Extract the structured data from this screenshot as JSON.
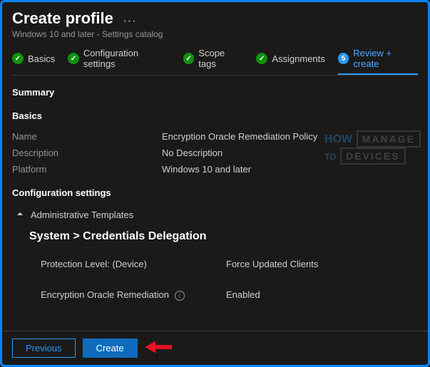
{
  "header": {
    "title": "Create profile",
    "subtitle": "Windows 10 and later - Settings catalog"
  },
  "wizard": {
    "steps": [
      {
        "label": "Basics"
      },
      {
        "label": "Configuration settings"
      },
      {
        "label": "Scope tags"
      },
      {
        "label": "Assignments"
      },
      {
        "label": "Review + create",
        "num": "5"
      }
    ]
  },
  "summary": {
    "heading": "Summary",
    "basics_heading": "Basics",
    "rows": {
      "name_k": "Name",
      "name_v": "Encryption Oracle Remediation Policy",
      "desc_k": "Description",
      "desc_v": "No Description",
      "plat_k": "Platform",
      "plat_v": "Windows 10 and later"
    }
  },
  "config": {
    "heading": "Configuration settings",
    "expander_label": "Administrative Templates",
    "path": "System > Credentials Delegation",
    "settings": {
      "protection_k": "Protection Level: (Device)",
      "protection_v": "Force Updated Clients",
      "remediation_k": "Encryption Oracle Remediation",
      "remediation_v": "Enabled"
    }
  },
  "footer": {
    "previous": "Previous",
    "create": "Create"
  },
  "watermark": {
    "how": "HOW",
    "to": "TO",
    "line1": "MANAGE",
    "line2": "DEVICES"
  }
}
